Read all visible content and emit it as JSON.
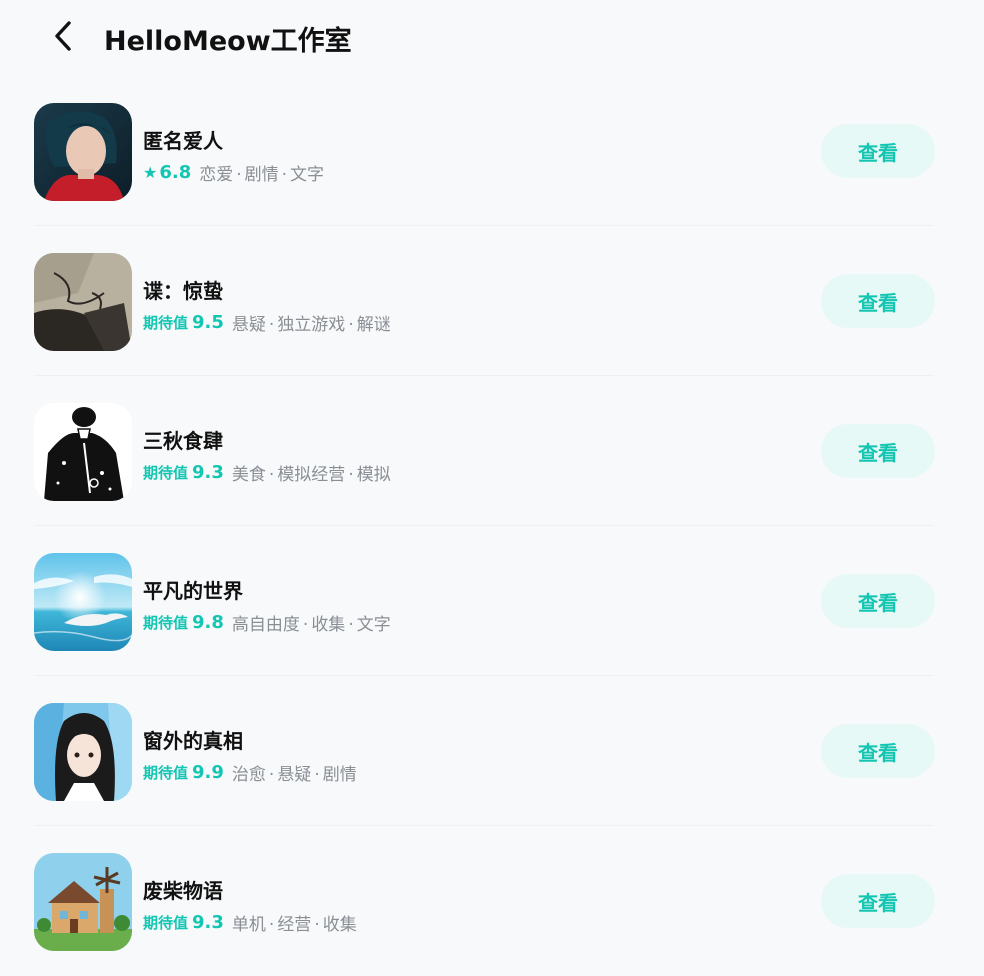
{
  "header": {
    "title": "HelloMeow工作室"
  },
  "colors": {
    "accent": "#14c6b2",
    "button_bg": "#e6f9f6",
    "background": "#f7f9fb"
  },
  "games": [
    {
      "name": "匿名爱人",
      "score_label": "",
      "score_icon": "star-icon",
      "score": "6.8",
      "tags": [
        "恋爱",
        "剧情",
        "文字"
      ],
      "button": "查看"
    },
    {
      "name": "谍：惊蛰",
      "score_label": "期待值",
      "score": "9.5",
      "tags": [
        "悬疑",
        "独立游戏",
        "解谜"
      ],
      "button": "查看"
    },
    {
      "name": "三秋食肆",
      "score_label": "期待值",
      "score": "9.3",
      "tags": [
        "美食",
        "模拟经营",
        "模拟"
      ],
      "button": "查看"
    },
    {
      "name": "平凡的世界",
      "score_label": "期待值",
      "score": "9.8",
      "tags": [
        "高自由度",
        "收集",
        "文字"
      ],
      "button": "查看"
    },
    {
      "name": "窗外的真相",
      "score_label": "期待值",
      "score": "9.9",
      "tags": [
        "治愈",
        "悬疑",
        "剧情"
      ],
      "button": "查看"
    },
    {
      "name": "废柴物语",
      "score_label": "期待值",
      "score": "9.3",
      "tags": [
        "单机",
        "经营",
        "收集"
      ],
      "button": "查看"
    }
  ]
}
